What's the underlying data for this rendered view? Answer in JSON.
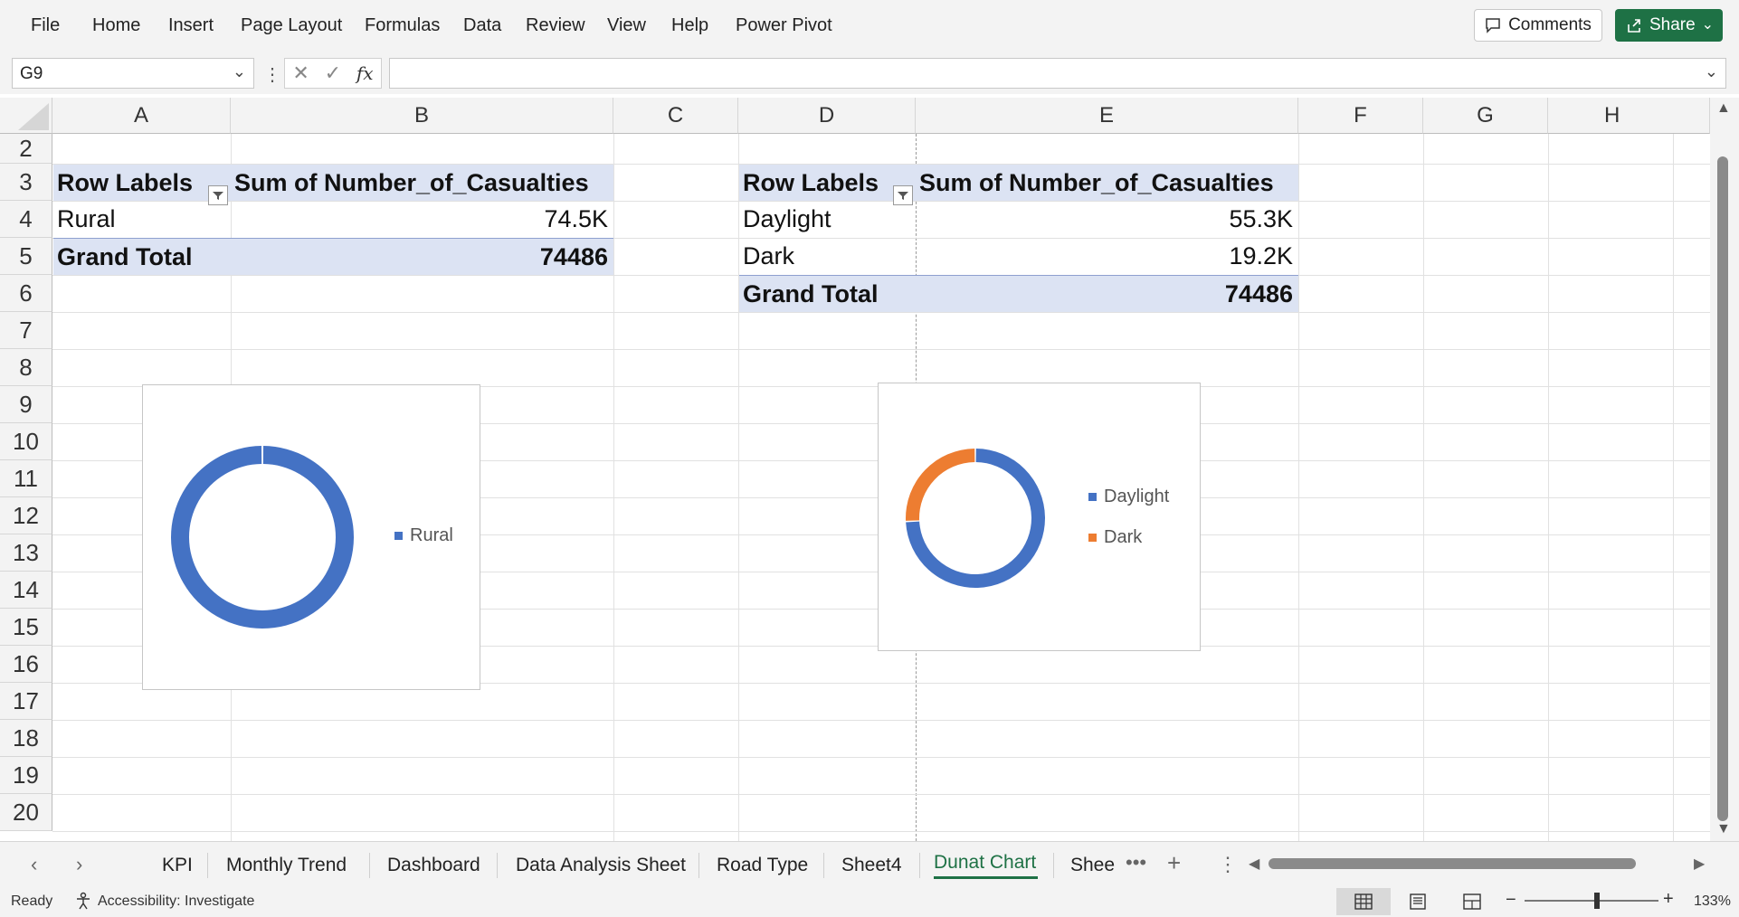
{
  "menu": [
    "File",
    "Home",
    "Insert",
    "Page Layout",
    "Formulas",
    "Data",
    "Review",
    "View",
    "Help",
    "Power Pivot"
  ],
  "actions": {
    "comments": "Comments",
    "share": "Share"
  },
  "formula_bar": {
    "name_box": "G9",
    "formula": "",
    "fx_label": "fx"
  },
  "columns": [
    "A",
    "B",
    "C",
    "D",
    "E",
    "F",
    "G",
    "H"
  ],
  "rows": [
    "2",
    "3",
    "4",
    "5",
    "6",
    "7",
    "8",
    "9",
    "10",
    "11",
    "12",
    "13",
    "14",
    "15",
    "16",
    "17",
    "18",
    "19",
    "20"
  ],
  "pivot_left": {
    "header_label": "Row Labels",
    "header_value": "Sum of Number_of_Casualties",
    "rows": [
      {
        "label": "Rural",
        "value": "74.5K"
      }
    ],
    "total_label": "Grand Total",
    "total_value": "74486"
  },
  "pivot_right": {
    "header_label": "Row Labels",
    "header_value": "Sum of Number_of_Casualties",
    "rows": [
      {
        "label": "Daylight",
        "value": "55.3K"
      },
      {
        "label": "Dark",
        "value": "19.2K"
      }
    ],
    "total_label": "Grand Total",
    "total_value": "74486"
  },
  "chart_data": [
    {
      "type": "pie",
      "style": "doughnut",
      "categories": [
        "Rural"
      ],
      "values": [
        74486
      ],
      "colors": [
        "#4472c4"
      ],
      "legend": "right"
    },
    {
      "type": "pie",
      "style": "doughnut",
      "categories": [
        "Daylight",
        "Dark"
      ],
      "values": [
        55300,
        19200
      ],
      "colors": [
        "#4472c4",
        "#ed7d31"
      ],
      "legend": "right"
    }
  ],
  "sheet_tabs": [
    "KPI",
    "Monthly Trend",
    "Dashboard",
    "Data Analysis Sheet",
    "Road Type",
    "Sheet4",
    "Dunat Chart",
    "Shee"
  ],
  "active_tab": "Dunat Chart",
  "status": {
    "ready": "Ready",
    "accessibility": "Accessibility: Investigate",
    "zoom": "133%"
  }
}
